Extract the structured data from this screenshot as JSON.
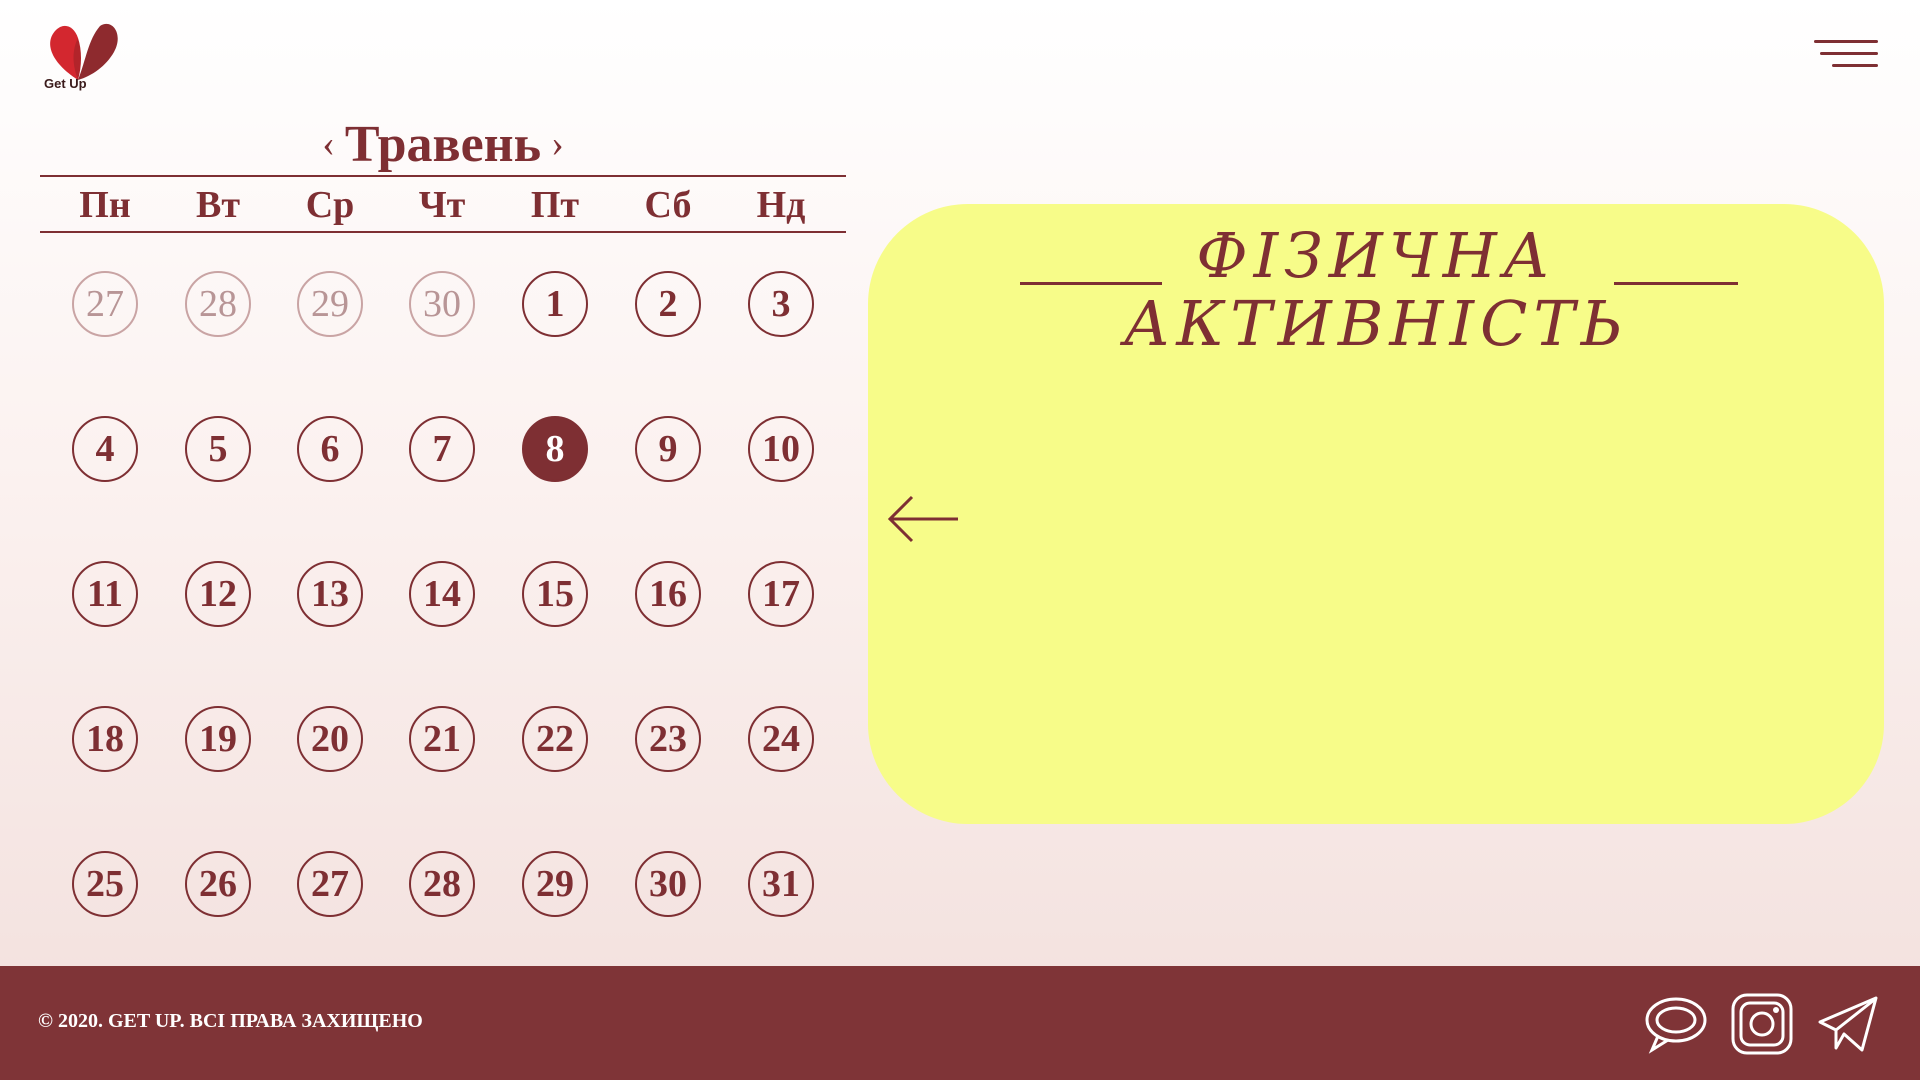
{
  "brand": {
    "logo_text": "Get Up"
  },
  "calendar": {
    "month": "Травень",
    "prev_arrow": "‹",
    "next_arrow": "›",
    "weekdays": [
      "Пн",
      "Вт",
      "Ср",
      "Чт",
      "Пт",
      "Сб",
      "Нд"
    ],
    "weeks": [
      [
        "27",
        "28",
        "29",
        "30",
        "1",
        "2",
        "3"
      ],
      [
        "4",
        "5",
        "6",
        "7",
        "8",
        "9",
        "10"
      ],
      [
        "11",
        "12",
        "13",
        "14",
        "15",
        "16",
        "17"
      ],
      [
        "18",
        "19",
        "20",
        "21",
        "22",
        "23",
        "24"
      ],
      [
        "25",
        "26",
        "27",
        "28",
        "29",
        "30",
        "31"
      ]
    ],
    "selected_day": "8"
  },
  "card": {
    "title_line1": "ФІЗИЧНА",
    "title_line2": "АКТИВНІСТЬ"
  },
  "footer": {
    "copyright": "© 2020. GET UP. ВСІ ПРАВА ЗАХИЩЕНО"
  },
  "colors": {
    "accent": "#7e2f33",
    "card": "#f7fc89",
    "footer": "#7f3437"
  },
  "icons": [
    "menu-icon",
    "back-arrow-icon",
    "chat-icon",
    "instagram-icon",
    "telegram-icon"
  ]
}
